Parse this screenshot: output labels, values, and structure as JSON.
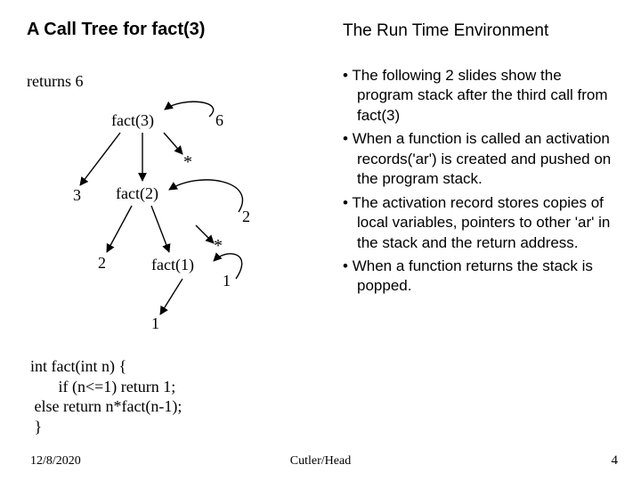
{
  "left": {
    "title": "A Call Tree for fact(3)",
    "returns_label": "returns 6",
    "nodes": {
      "fact3": "fact(3)",
      "fact2": "fact(2)",
      "fact1": "fact(1)",
      "val6": "6",
      "val3": "3",
      "val2l": "2",
      "val2r": "2",
      "val1b": "1",
      "val1r": "1",
      "op1": "*",
      "op2": "*"
    }
  },
  "right": {
    "title": "The Run Time Environment",
    "bullets": [
      "The following 2 slides show the program stack after the third call from fact(3)",
      "When a function is called an activation records('ar')  is created and pushed on the program stack.",
      "The activation record stores copies of local variables, pointers to other 'ar' in the stack and the return address.",
      "When a function returns the stack is popped."
    ]
  },
  "code": "int fact(int n) {\n       if (n<=1) return 1;\n else return n*fact(n-1);\n }",
  "footer": {
    "date": "12/8/2020",
    "center": "Cutler/Head",
    "page": "4"
  }
}
